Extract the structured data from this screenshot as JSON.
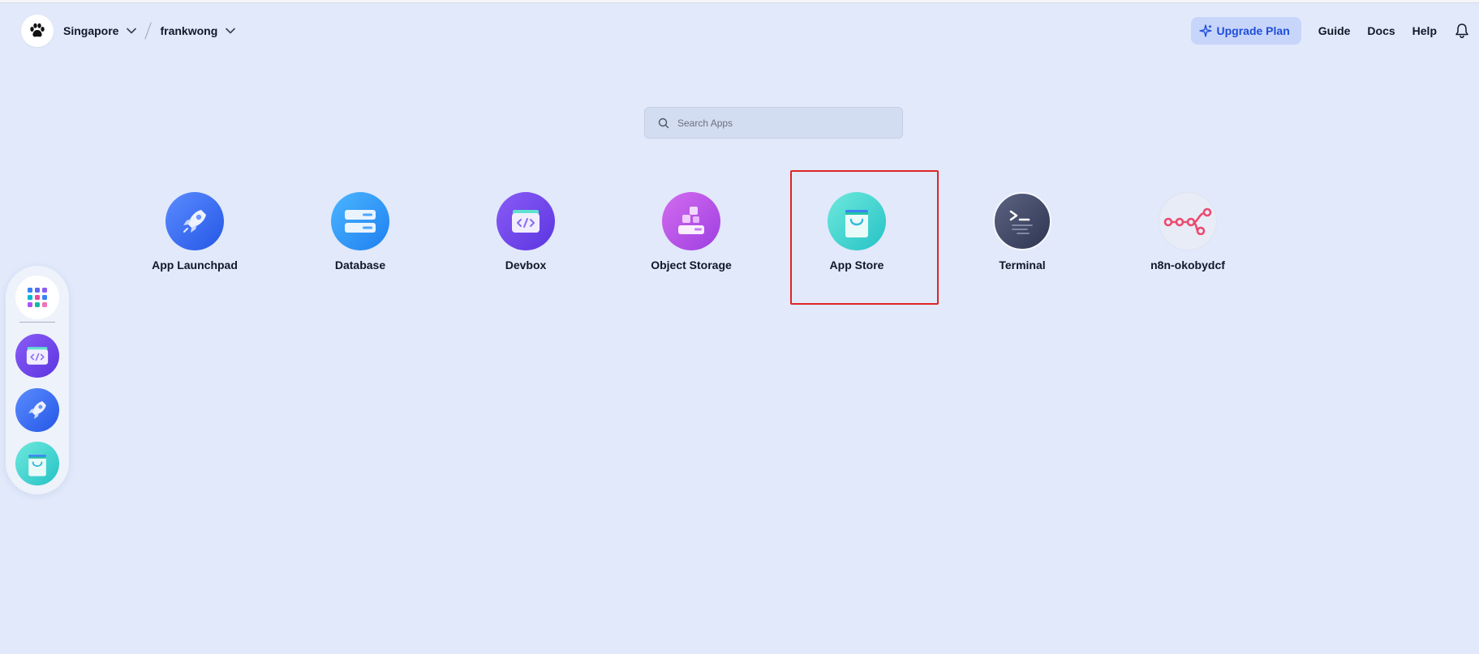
{
  "header": {
    "region": "Singapore",
    "workspace": "frankwong",
    "upgrade_label": "Upgrade Plan",
    "links": {
      "guide": "Guide",
      "docs": "Docs",
      "help": "Help"
    }
  },
  "search": {
    "placeholder": "Search Apps"
  },
  "apps": [
    {
      "label": "App Launchpad",
      "icon": "rocket-icon"
    },
    {
      "label": "Database",
      "icon": "database-icon"
    },
    {
      "label": "Devbox",
      "icon": "devbox-icon"
    },
    {
      "label": "Object Storage",
      "icon": "object-storage-icon"
    },
    {
      "label": "App Store",
      "icon": "shopping-bag-icon"
    },
    {
      "label": "Terminal",
      "icon": "terminal-icon"
    },
    {
      "label": "n8n-okobydcf",
      "icon": "n8n-icon"
    }
  ],
  "dock": {
    "items": [
      "grid-icon",
      "devbox-icon",
      "rocket-icon",
      "shopping-bag-icon"
    ]
  },
  "colors": {
    "background": "#e1e9fb",
    "accent": "#1d4ed8",
    "highlight": "#e02424"
  }
}
